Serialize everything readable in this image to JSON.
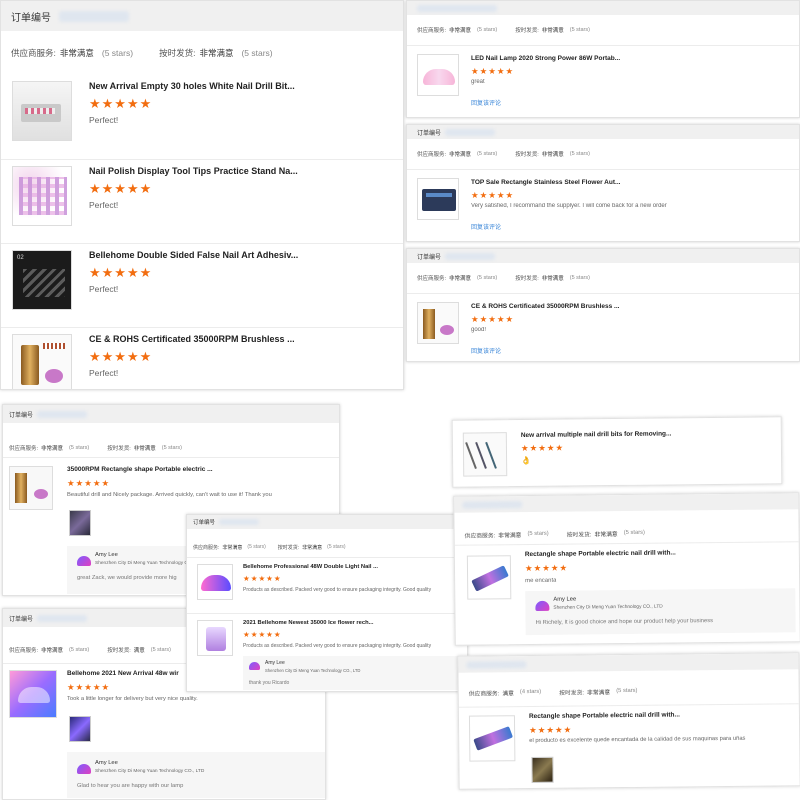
{
  "order_label": "订单编号",
  "supplier_service": "供应商服务:",
  "on_time": "按时发货:",
  "sat": "非常满意",
  "satisfied": "满意",
  "stars_5": "(5 stars)",
  "stars_4": "(4 stars)",
  "stars_glyphs": "★★★★★",
  "add_review": "回复该评论",
  "seller_name": "Amy Lee",
  "seller_company": "Shenzhen City Di Meng Yuan Technology CO., LTD",
  "p1": {
    "items": [
      {
        "title": "New Arrival Empty 30 holes White Nail Drill Bit...",
        "review": "Perfect!"
      },
      {
        "title": "Nail Polish Display Tool Tips Practice Stand Na...",
        "review": "Perfect!"
      },
      {
        "title": "Bellehome Double Sided False Nail Art Adhesiv...",
        "review": "Perfect!",
        "badge": "02"
      },
      {
        "title": "CE & ROHS Certificated 35000RPM Brushless ...",
        "review": "Perfect!"
      }
    ]
  },
  "p2": {
    "title": "LED Nail Lamp 2020 Strong Power 86W Portab...",
    "review": "great"
  },
  "p3": {
    "title": "TOP Sale Rectangle Stainless Steel Flower Aut...",
    "review": "Very satisfied, I recommand the supplyer. I will come back for a new order"
  },
  "p4": {
    "title": "CE & ROHS Certificated 35000RPM Brushless ...",
    "review": "good!"
  },
  "p5": {
    "title": "35000RPM Rectangle shape Portable electric ...",
    "review": "Beautiful drill and Nicely package.  Arrived quickly, can't wait to use it! Thank you",
    "reply": "great Zack,  we would provide more hig"
  },
  "p6": {
    "title": "Bellehome 2021 New Arrival 48w wir",
    "review": "Took a little longer for delivery but very nice quality.",
    "reply": "Glad to hear you are happy with our lamp"
  },
  "p7": {
    "items": [
      {
        "title": "Bellehome Professional 48W Double Light Nail ...",
        "review": "Products as described. Packed very good to ensure packaging integrity. Good quality"
      },
      {
        "title": "2021 Bellehome Newest 35000 Ice flower rech...",
        "review": "Products as described. Packed very good to ensure packaging integrity. Good quality"
      }
    ],
    "reply": "thank you Ricardo"
  },
  "p8": {
    "title": "New arrival multiple nail drill bits for Removing...",
    "review": "👌"
  },
  "p9": {
    "title": "Rectangle shape Portable electric nail drill with...",
    "review": "me encanta",
    "reply": "Hi Richely, It is good choice and hope our product help your business"
  },
  "p10": {
    "title": "Rectangle shape Portable electric nail drill with...",
    "review": "el producto es excelente quede encantada de la calidad de sus maquinas para uñas"
  }
}
